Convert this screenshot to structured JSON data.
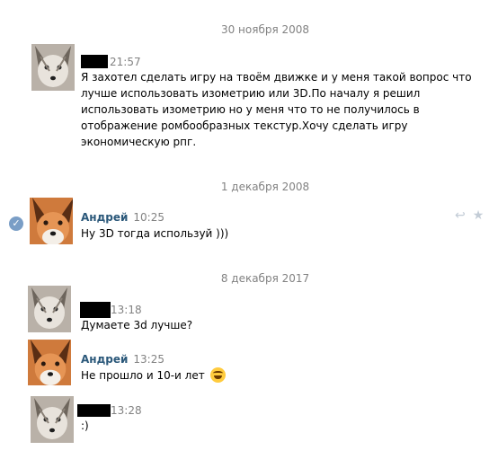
{
  "colors": {
    "author": "#2b587a",
    "meta": "#828282",
    "read_badge": "#7a9ec6",
    "redaction": "#000000"
  },
  "dates": [
    "30 ноября 2008",
    "1 декабря 2008",
    "8 декабря 2017"
  ],
  "messages": [
    {
      "author": "",
      "time": "21:57",
      "text_lines": [
        "Я захотел сделать игру на твоём движке и у меня такой вопрос что",
        "лучше использовать изометрию или 3D.По началу я решил",
        "использовать изометрию но у меня что то не получилось в",
        "отображение ромбообразных текстур.Хочу сделать игру",
        "экономическую рпг."
      ]
    },
    {
      "author": "Андрей",
      "time": "10:25",
      "text_lines": [
        "Ну 3D тогда используй )))"
      ]
    },
    {
      "author": "",
      "time": "13:18",
      "text_lines": [
        "Думаете 3d лучше?"
      ]
    },
    {
      "author": "Андрей",
      "time": "13:25",
      "text_lines": [
        "Не прошло и 10-и лет"
      ],
      "emoji": "laughing-tears-emoji"
    },
    {
      "author": "",
      "time": "13:28",
      "text_lines": [
        ":)"
      ]
    }
  ],
  "icons": {
    "read": "checkmark-icon",
    "reply": "reply-icon",
    "star": "star-icon"
  }
}
